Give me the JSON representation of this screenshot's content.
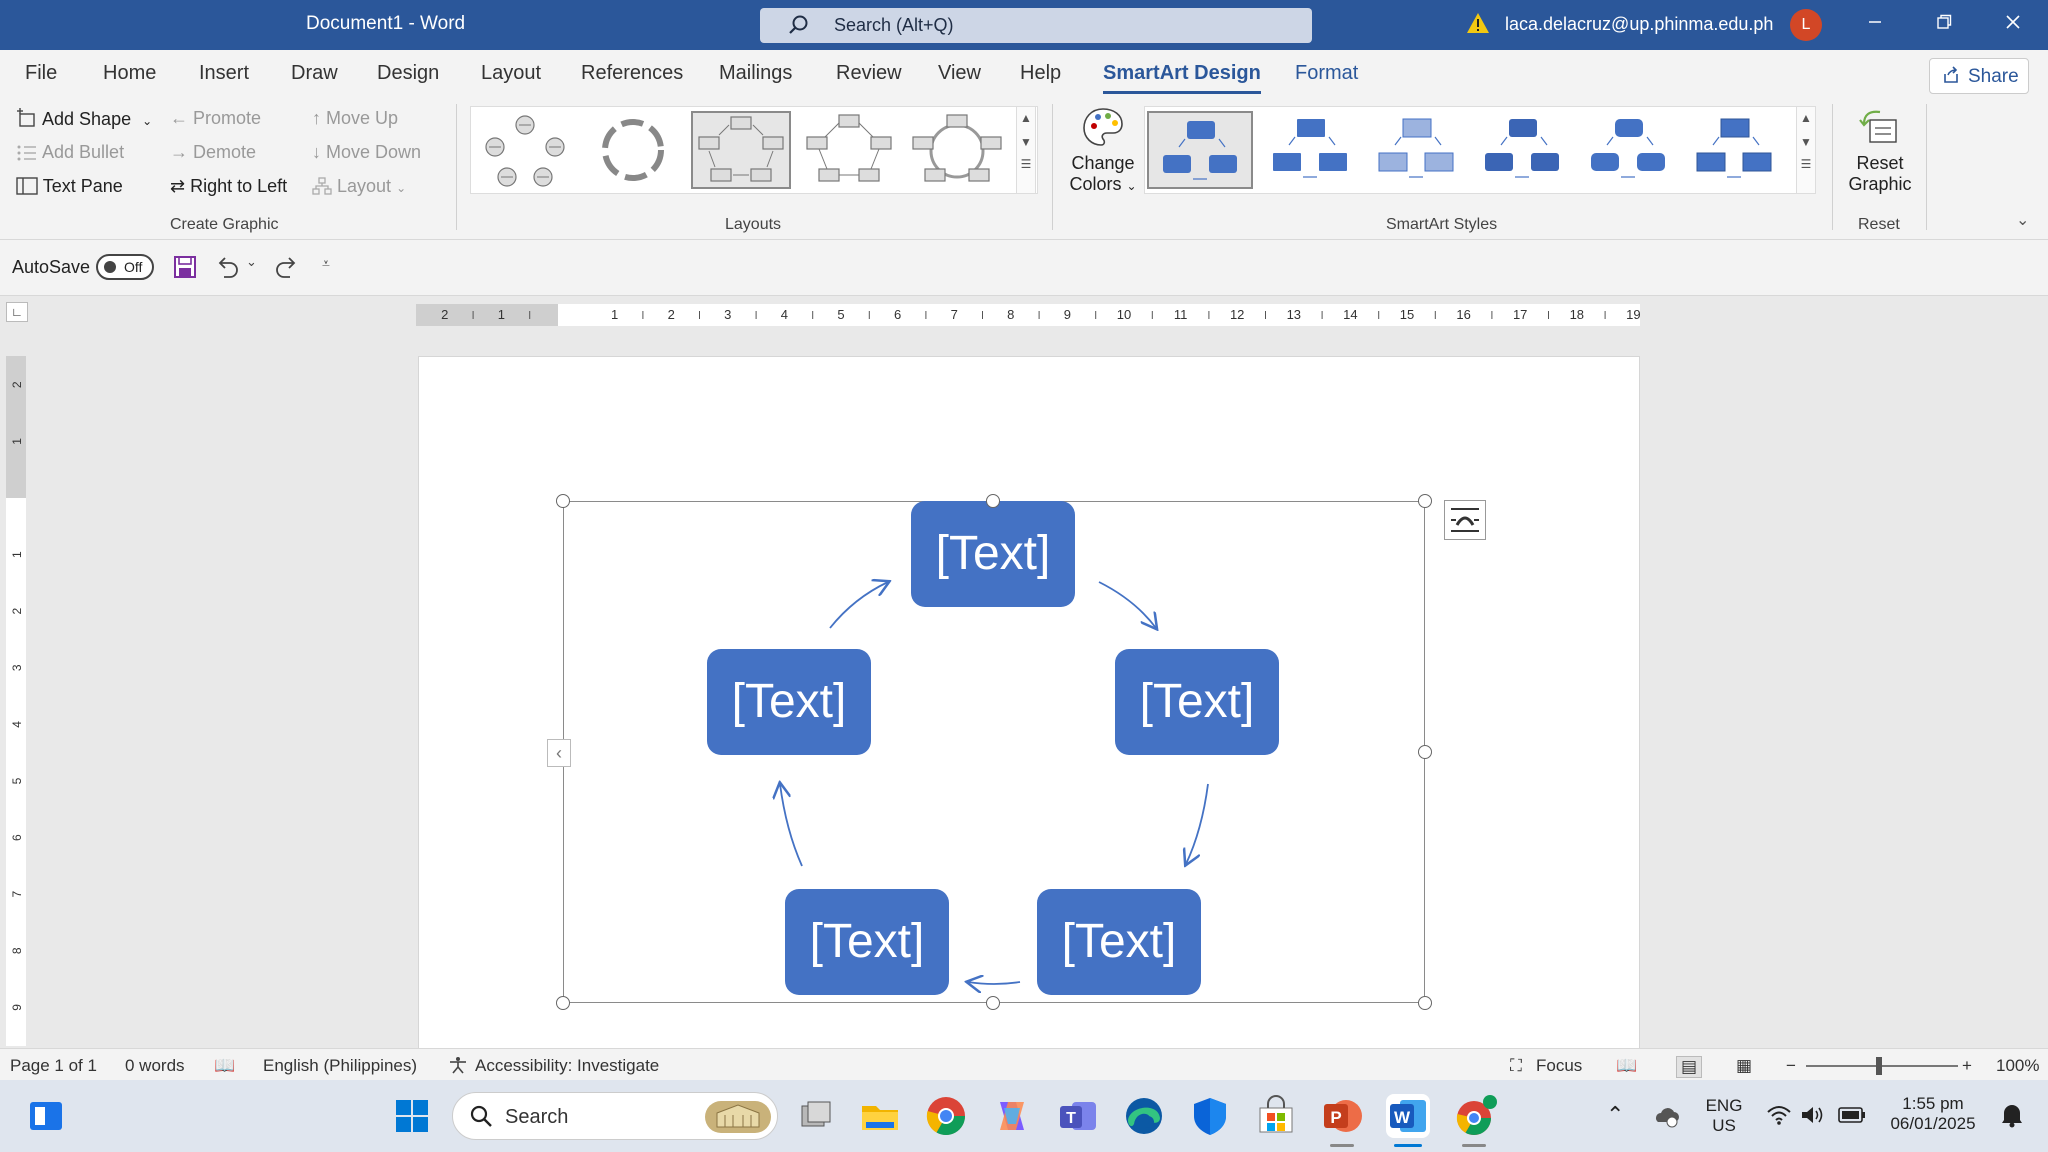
{
  "titlebar": {
    "doc_title": "Document1  -  Word",
    "search_text": "Search (Alt+Q)",
    "account": "laca.delacruz@up.phinma.edu.ph",
    "avatar_letter": "L"
  },
  "tabs": [
    "File",
    "Home",
    "Insert",
    "Draw",
    "Design",
    "Layout",
    "References",
    "Mailings",
    "Review",
    "View",
    "Help",
    "SmartArt Design",
    "Format"
  ],
  "share_label": "Share",
  "ribbon": {
    "create_graphic": {
      "add_shape": "Add Shape",
      "add_bullet": "Add Bullet",
      "text_pane": "Text Pane",
      "promote": "Promote",
      "demote": "Demote",
      "right_to_left": "Right to Left",
      "move_up": "Move Up",
      "move_down": "Move Down",
      "layout": "Layout",
      "label": "Create Graphic"
    },
    "layouts_label": "Layouts",
    "change_colors_line1": "Change",
    "change_colors_line2": "Colors",
    "smartart_styles_label": "SmartArt Styles",
    "reset_line1": "Reset",
    "reset_line2": "Graphic",
    "reset_label": "Reset"
  },
  "qat": {
    "autosave": "AutoSave",
    "toggle_state": "Off"
  },
  "ruler_numbers": [
    "2",
    "1",
    "1",
    "2",
    "3",
    "4",
    "5",
    "6",
    "7",
    "8",
    "9",
    "10",
    "11",
    "12",
    "13",
    "14",
    "15",
    "16",
    "17",
    "18",
    "19"
  ],
  "vruler_numbers": [
    "2",
    "1",
    "1",
    "2",
    "3",
    "4",
    "5",
    "6",
    "7",
    "8",
    "9"
  ],
  "smartart": {
    "nodes": [
      "[Text]",
      "[Text]",
      "[Text]",
      "[Text]",
      "[Text]"
    ],
    "color": "#4472c4"
  },
  "statusbar": {
    "page": "Page 1 of 1",
    "words": "0 words",
    "language": "English (Philippines)",
    "accessibility": "Accessibility: Investigate",
    "focus": "Focus",
    "zoom": "100%"
  },
  "taskbar": {
    "search": "Search",
    "lang_line1": "ENG",
    "lang_line2": "US",
    "time": "1:55 pm",
    "date": "06/01/2025"
  },
  "colors": {
    "title_bar": "#2b579a",
    "accent": "#2b579a",
    "smartart_fill": "#4472c4"
  }
}
